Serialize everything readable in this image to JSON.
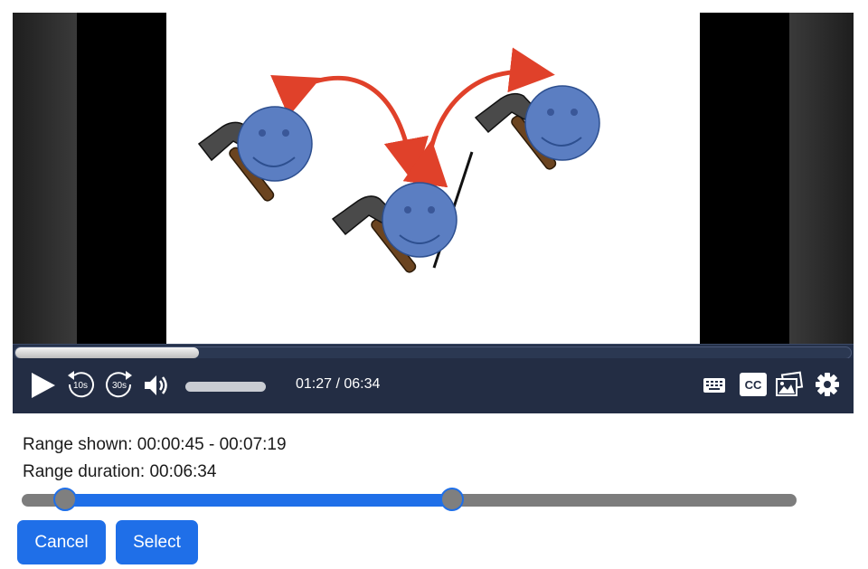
{
  "player": {
    "time_display": "01:27 / 06:34",
    "progress_fraction": 0.22,
    "skip_back_label": "10s",
    "skip_forward_label": "30s",
    "captions_label": "CC",
    "colors": {
      "control_bar": "#232d44",
      "face_fill": "#5b7ec2",
      "arrow": "#e0412a"
    }
  },
  "range": {
    "shown_text": "Range shown: 00:00:45 - 00:07:19",
    "duration_text": "Range duration: 00:06:34",
    "start_fraction": 0.056,
    "end_fraction": 0.555,
    "accent": "#1f6fe8"
  },
  "buttons": {
    "cancel": "Cancel",
    "select": "Select"
  },
  "icons": [
    "play-icon",
    "replay-10-icon",
    "forward-30-icon",
    "volume-icon",
    "keyboard-icon",
    "captions-icon",
    "gallery-icon",
    "settings-icon"
  ]
}
